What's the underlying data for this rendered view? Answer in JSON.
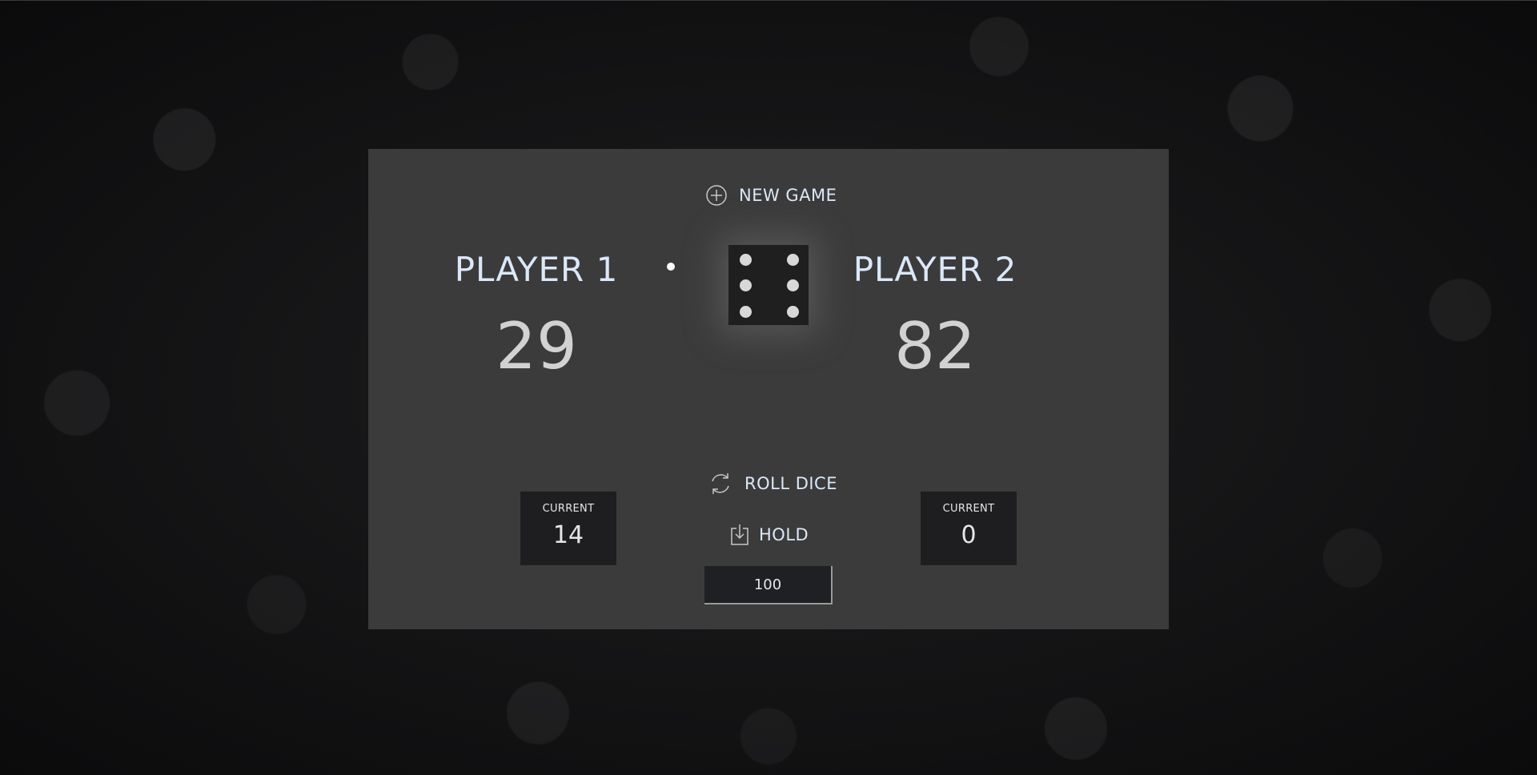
{
  "controls": {
    "new_game_label": "NEW GAME",
    "roll_dice_label": "ROLL DICE",
    "hold_label": "HOLD",
    "new_game_icon": "plus-circle-icon",
    "roll_dice_icon": "refresh-icon",
    "hold_icon": "download-icon"
  },
  "players": [
    {
      "name": "PLAYER 1",
      "score": "29",
      "current_label": "CURRENT",
      "current_score": "14",
      "active": true
    },
    {
      "name": "PLAYER 2",
      "score": "82",
      "current_label": "CURRENT",
      "current_score": "0",
      "active": false
    }
  ],
  "dice": {
    "value": 6
  },
  "target_score": {
    "value": "100"
  },
  "colors": {
    "text_accent": "#dbe8f8",
    "panel": "#3b3b3b",
    "box": "#1e1e20",
    "dice": "#1f1f1f"
  }
}
